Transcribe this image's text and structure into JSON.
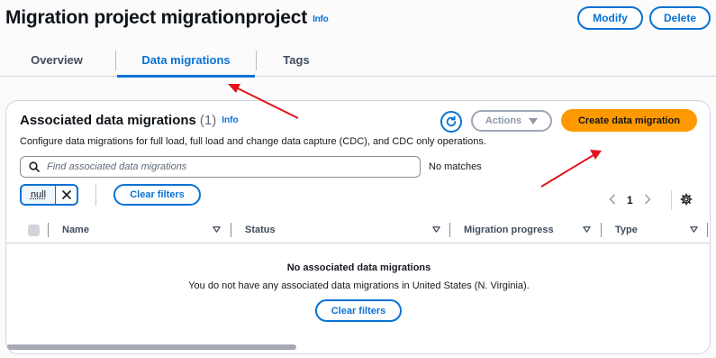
{
  "header": {
    "title": "Migration project migrationproject",
    "info": "Info",
    "modify_label": "Modify",
    "delete_label": "Delete"
  },
  "tabs": [
    {
      "label": "Overview",
      "active": false
    },
    {
      "label": "Data migrations",
      "active": true
    },
    {
      "label": "Tags",
      "active": false
    }
  ],
  "panel": {
    "title": "Associated data migrations",
    "count": "(1)",
    "info": "Info",
    "description": "Configure data migrations for full load, full load and change data capture (CDC), and CDC only operations.",
    "actions_label": "Actions",
    "create_label": "Create data migration",
    "search_placeholder": "Find associated data migrations",
    "search_value": "",
    "matches_text": "No matches",
    "filter_token": "null",
    "clear_filters_label": "Clear filters",
    "page_number": "1"
  },
  "table": {
    "columns": [
      "Name",
      "Status",
      "Migration progress",
      "Type"
    ],
    "empty_title": "No associated data migrations",
    "empty_description": "You do not have any associated data migrations in United States (N. Virginia).",
    "empty_clear_label": "Clear filters"
  },
  "colors": {
    "accent": "#0972d3",
    "primary_button": "#ff9900",
    "annotation_arrow": "#e0141e"
  },
  "icons": [
    "refresh-icon",
    "caret-down-icon",
    "search-icon",
    "close-icon",
    "chevron-left-icon",
    "chevron-right-icon",
    "gear-icon",
    "sort-icon"
  ]
}
